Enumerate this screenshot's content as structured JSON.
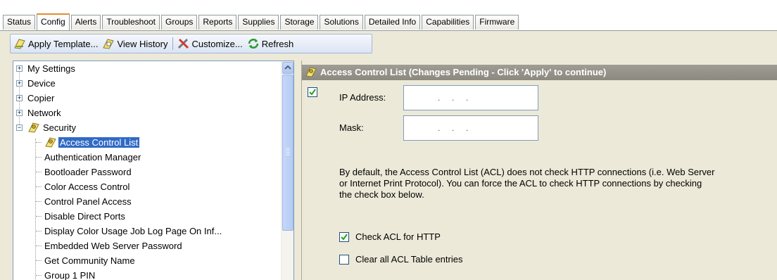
{
  "tabs": [
    "Status",
    "Config",
    "Alerts",
    "Troubleshoot",
    "Groups",
    "Reports",
    "Supplies",
    "Storage",
    "Solutions",
    "Detailed Info",
    "Capabilities",
    "Firmware"
  ],
  "active_tab": "Config",
  "toolbar": {
    "apply_template": "Apply Template...",
    "view_history": "View History",
    "customize": "Customize...",
    "refresh": "Refresh"
  },
  "tree": {
    "top_items": [
      "My Settings",
      "Device",
      "Copier",
      "Network",
      "Security"
    ],
    "security_children": [
      "Access Control List",
      "Authentication Manager",
      "Bootloader Password",
      "Color Access Control",
      "Control Panel Access",
      "Disable Direct Ports",
      "Display Color Usage Job Log Page On Inf...",
      "Embedded Web Server Password",
      "Get Community Name",
      "Group 1 PIN"
    ],
    "selected": "Access Control List"
  },
  "panel": {
    "title": "Access Control List (Changes Pending - Click 'Apply' to continue)",
    "ip_label": "IP Address:",
    "mask_label": "Mask:",
    "ip_dots": ".     .     .",
    "mask_dots": ".     .     .",
    "description_lines": [
      "By default, the Access Control List (ACL) does not check HTTP connections (i.e. Web Server",
      "or Internet Print Protocol).  You can force the ACL to check HTTP connections by checking",
      "the check box below."
    ],
    "check_http_label": "Check ACL for HTTP",
    "check_http_checked": true,
    "clear_acl_label": "Clear all ACL Table entries",
    "clear_acl_checked": false,
    "entry_checked": true
  },
  "colors": {
    "selection": "#316ac5",
    "header_bar": "#9e9c93",
    "active_tab_accent": "#e68b2c"
  }
}
